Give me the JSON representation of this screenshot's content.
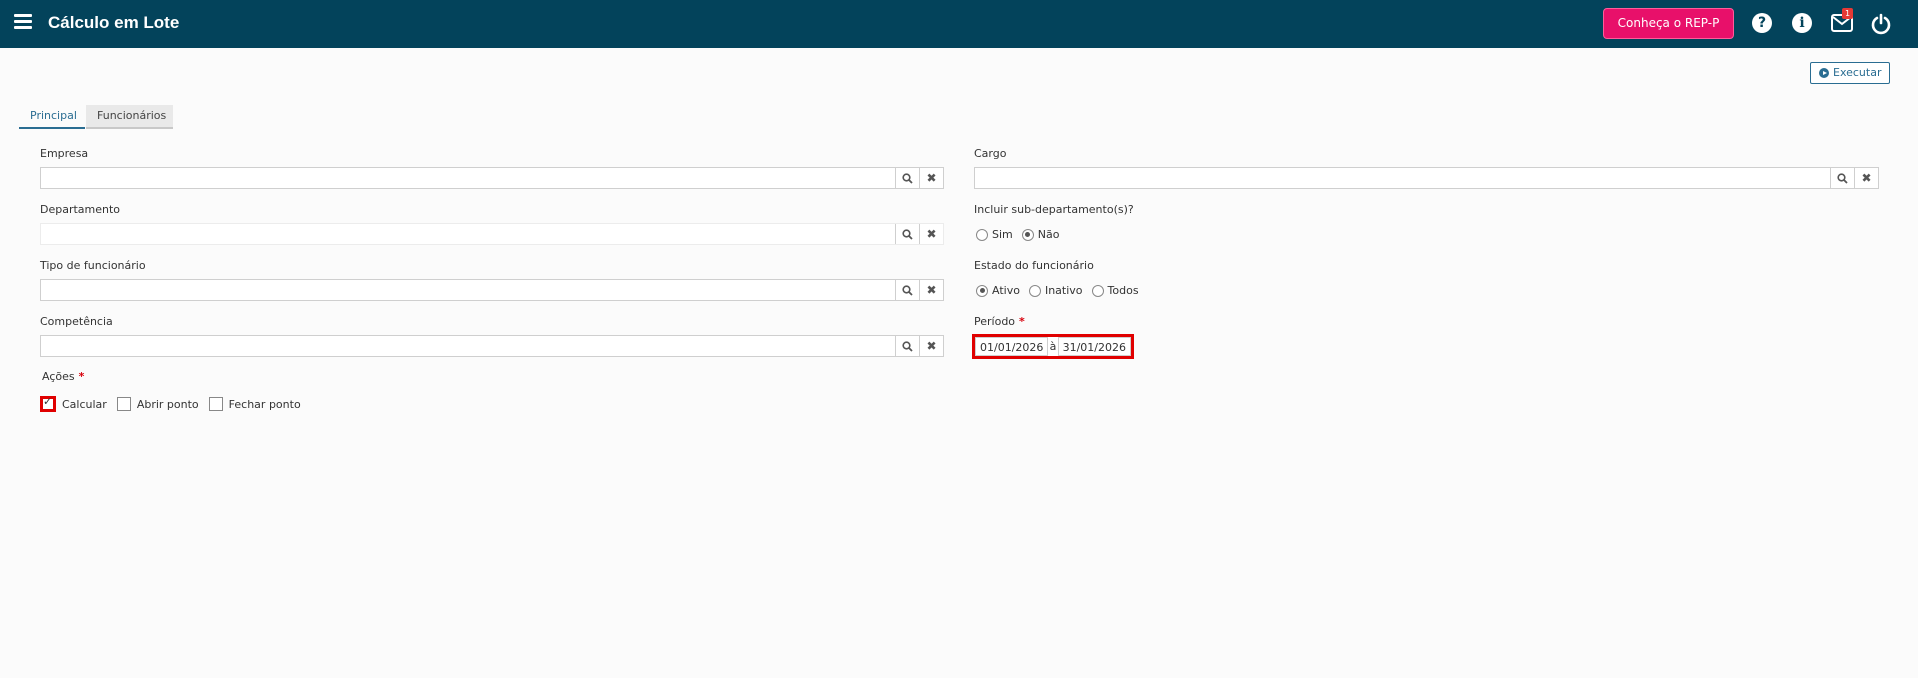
{
  "header": {
    "title": "Cálculo em Lote",
    "rep_button": "Conheça o REP-P",
    "help_icon": "?",
    "info_icon": "i",
    "mail_badge": "1"
  },
  "toolbar": {
    "execute_label": "Executar"
  },
  "tabs": [
    {
      "label": "Principal",
      "active": true
    },
    {
      "label": "Funcionários",
      "active": false
    }
  ],
  "fields": {
    "empresa": {
      "label": "Empresa",
      "value": ""
    },
    "departamento": {
      "label": "Departamento",
      "value": ""
    },
    "tipo_funcionario": {
      "label": "Tipo de funcionário",
      "value": ""
    },
    "competencia": {
      "label": "Competência",
      "value": ""
    },
    "cargo": {
      "label": "Cargo",
      "value": ""
    }
  },
  "sub_departamentos": {
    "label": "Incluir sub-departamento(s)?",
    "options": [
      {
        "label": "Sim",
        "selected": false
      },
      {
        "label": "Não",
        "selected": true
      }
    ]
  },
  "estado": {
    "label": "Estado do funcionário",
    "options": [
      {
        "label": "Ativo",
        "selected": true
      },
      {
        "label": "Inativo",
        "selected": false
      },
      {
        "label": "Todos",
        "selected": false
      }
    ]
  },
  "periodo": {
    "label": "Período",
    "required_mark": "*",
    "start": "01/01/2026",
    "separator": "à",
    "end": "31/01/2026"
  },
  "acoes": {
    "label": "Ações",
    "required_mark": "*",
    "options": [
      {
        "label": "Calcular",
        "checked": true
      },
      {
        "label": "Abrir ponto",
        "checked": false
      },
      {
        "label": "Fechar ponto",
        "checked": false
      }
    ]
  },
  "colors": {
    "header_bg": "#03435b",
    "accent": "#2a6d92",
    "rep_button": "#e8106a",
    "highlight": "#e00000"
  }
}
